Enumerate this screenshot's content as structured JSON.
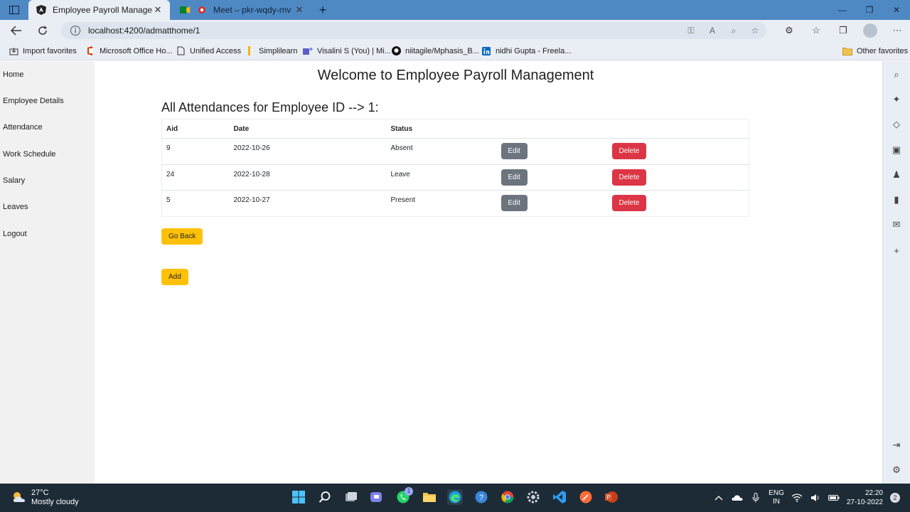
{
  "browser": {
    "tabs": [
      {
        "title": "Employee Payroll Management",
        "active": true
      },
      {
        "title": "Meet – pkr-wqdy-rnv",
        "active": false
      }
    ],
    "url": "localhost:4200/admatthome/1",
    "favorites": [
      "Import favorites",
      "Microsoft Office Ho...",
      "Unified Access",
      "Simplilearn",
      "Visalini S (You) | Mi...",
      "niitagile/Mphasis_B...",
      "nidhi Gupta - Freela..."
    ],
    "other_favorites": "Other favorites"
  },
  "sidebar": {
    "items": [
      {
        "label": "Home"
      },
      {
        "label": "Employee Details"
      },
      {
        "label": "Attendance"
      },
      {
        "label": "Work Schedule"
      },
      {
        "label": "Salary"
      },
      {
        "label": "Leaves"
      },
      {
        "label": "Logout"
      }
    ]
  },
  "main": {
    "title": "Welcome to Employee Payroll Management",
    "section_title": "All Attendances for Employee ID --> 1:",
    "columns": [
      "Aid",
      "Date",
      "Status"
    ],
    "rows": [
      {
        "aid": "9",
        "date": "2022-10-26",
        "status": "Absent"
      },
      {
        "aid": "24",
        "date": "2022-10-28",
        "status": "Leave"
      },
      {
        "aid": "5",
        "date": "2022-10-27",
        "status": "Present"
      }
    ],
    "edit_label": "Edit",
    "delete_label": "Delete",
    "go_back_label": "Go Back",
    "add_label": "Add"
  },
  "taskbar": {
    "temperature": "27°C",
    "weather": "Mostly cloudy",
    "lang_1": "ENG",
    "lang_2": "IN",
    "time": "22:20",
    "date": "27-10-2022",
    "teams_badge": "1",
    "notifications_count": "2"
  },
  "colors": {
    "edit": "#6c757d",
    "delete": "#dc3545",
    "warning": "#ffc107",
    "tabstrip": "#4f89c4"
  }
}
